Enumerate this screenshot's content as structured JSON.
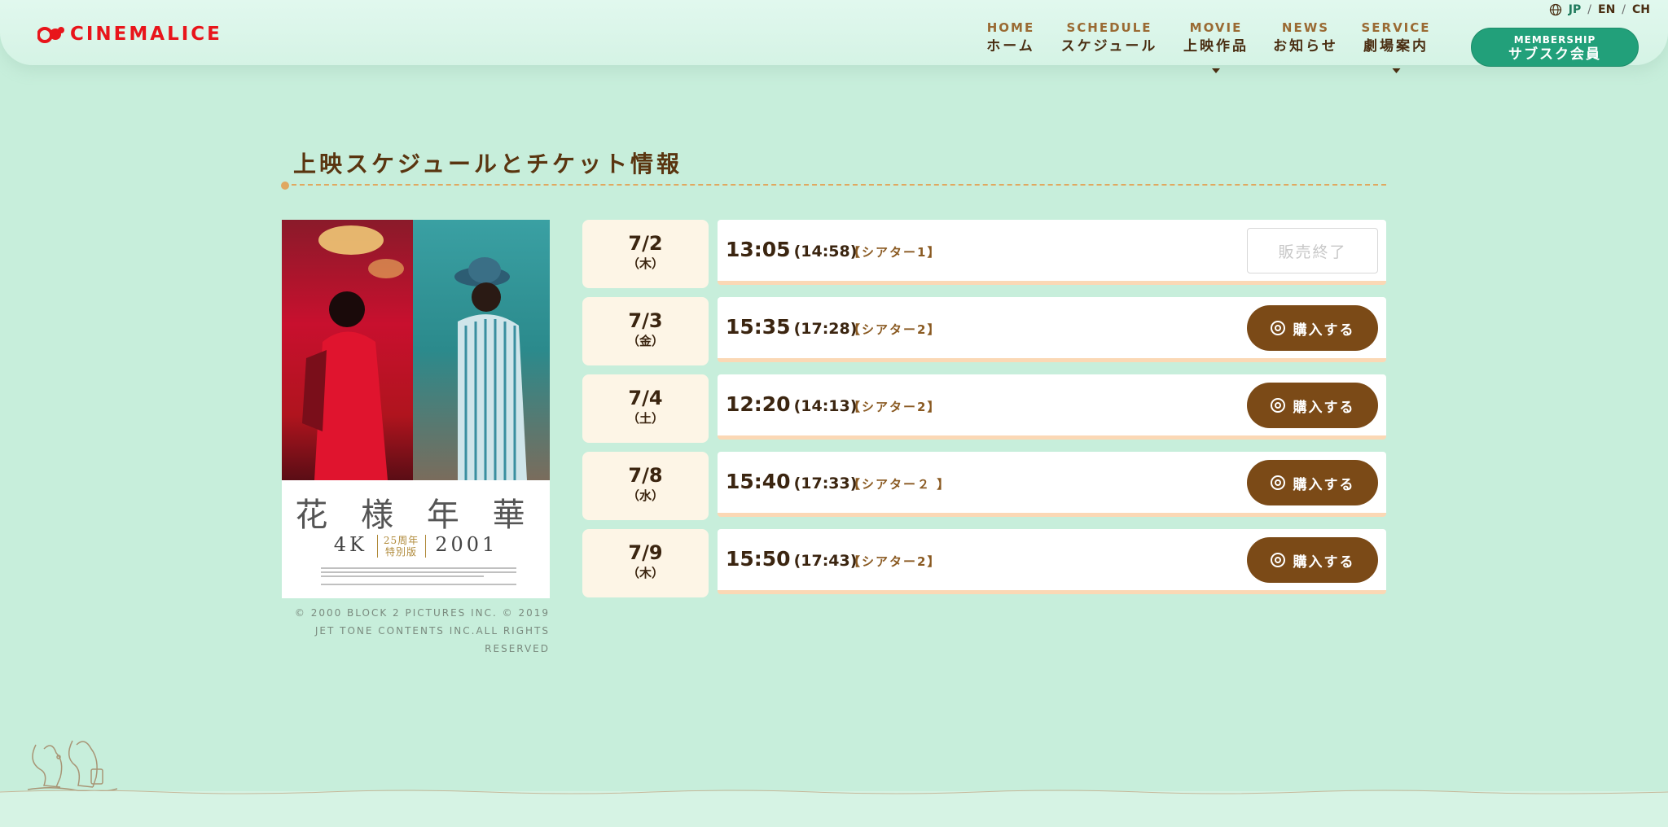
{
  "brand": {
    "name": "CINEMALICE",
    "color": "#e8151b"
  },
  "lang": {
    "icon": "globe-icon",
    "items": [
      "JP",
      "EN",
      "CH"
    ],
    "active": "JP",
    "separator": "/"
  },
  "nav": [
    {
      "en": "HOME",
      "jp": "ホーム",
      "dropdown": false
    },
    {
      "en": "SCHEDULE",
      "jp": "スケジュール",
      "dropdown": false
    },
    {
      "en": "MOVIE",
      "jp": "上映作品",
      "dropdown": true
    },
    {
      "en": "NEWS",
      "jp": "お知らせ",
      "dropdown": false
    },
    {
      "en": "SERVICE",
      "jp": "劇場案内",
      "dropdown": true
    }
  ],
  "membership": {
    "line1": "MEMBERSHIP",
    "line2": "サブスク会員"
  },
  "section": {
    "title": "上映スケジュールとチケット情報"
  },
  "poster": {
    "title": "花 様 年 華",
    "sub_left": "4K",
    "sub_mid": "25周年 特別版",
    "sub_right": "2001"
  },
  "copyright": "© 2000 BLOCK 2 PICTURES INC. © 2019 JET TONE CONTENTS INC.ALL RIGHTS RESERVED",
  "schedule": [
    {
      "date": "7/2",
      "dow": "（木）",
      "start": "13:05",
      "end": "(14:58)",
      "theater": "【シアター1】",
      "status": "販売終了",
      "available": false
    },
    {
      "date": "7/3",
      "dow": "（金）",
      "start": "15:35",
      "end": "(17:28)",
      "theater": "【シアター2】",
      "status": "購入する",
      "available": true
    },
    {
      "date": "7/4",
      "dow": "（土）",
      "start": "12:20",
      "end": "(14:13)",
      "theater": "【シアター2】",
      "status": "購入する",
      "available": true
    },
    {
      "date": "7/8",
      "dow": "（水）",
      "start": "15:40",
      "end": "(17:33)",
      "theater": "【シアター２ 】",
      "status": "購入する",
      "available": true
    },
    {
      "date": "7/9",
      "dow": "（木）",
      "start": "15:50",
      "end": "(17:43)",
      "theater": "【シアター2】",
      "status": "購入する",
      "available": true
    }
  ],
  "colors": {
    "background": "#c7eedb",
    "brown": "#7b4a17",
    "membership": "#22a07a",
    "date_bg": "#fdf5e6"
  }
}
